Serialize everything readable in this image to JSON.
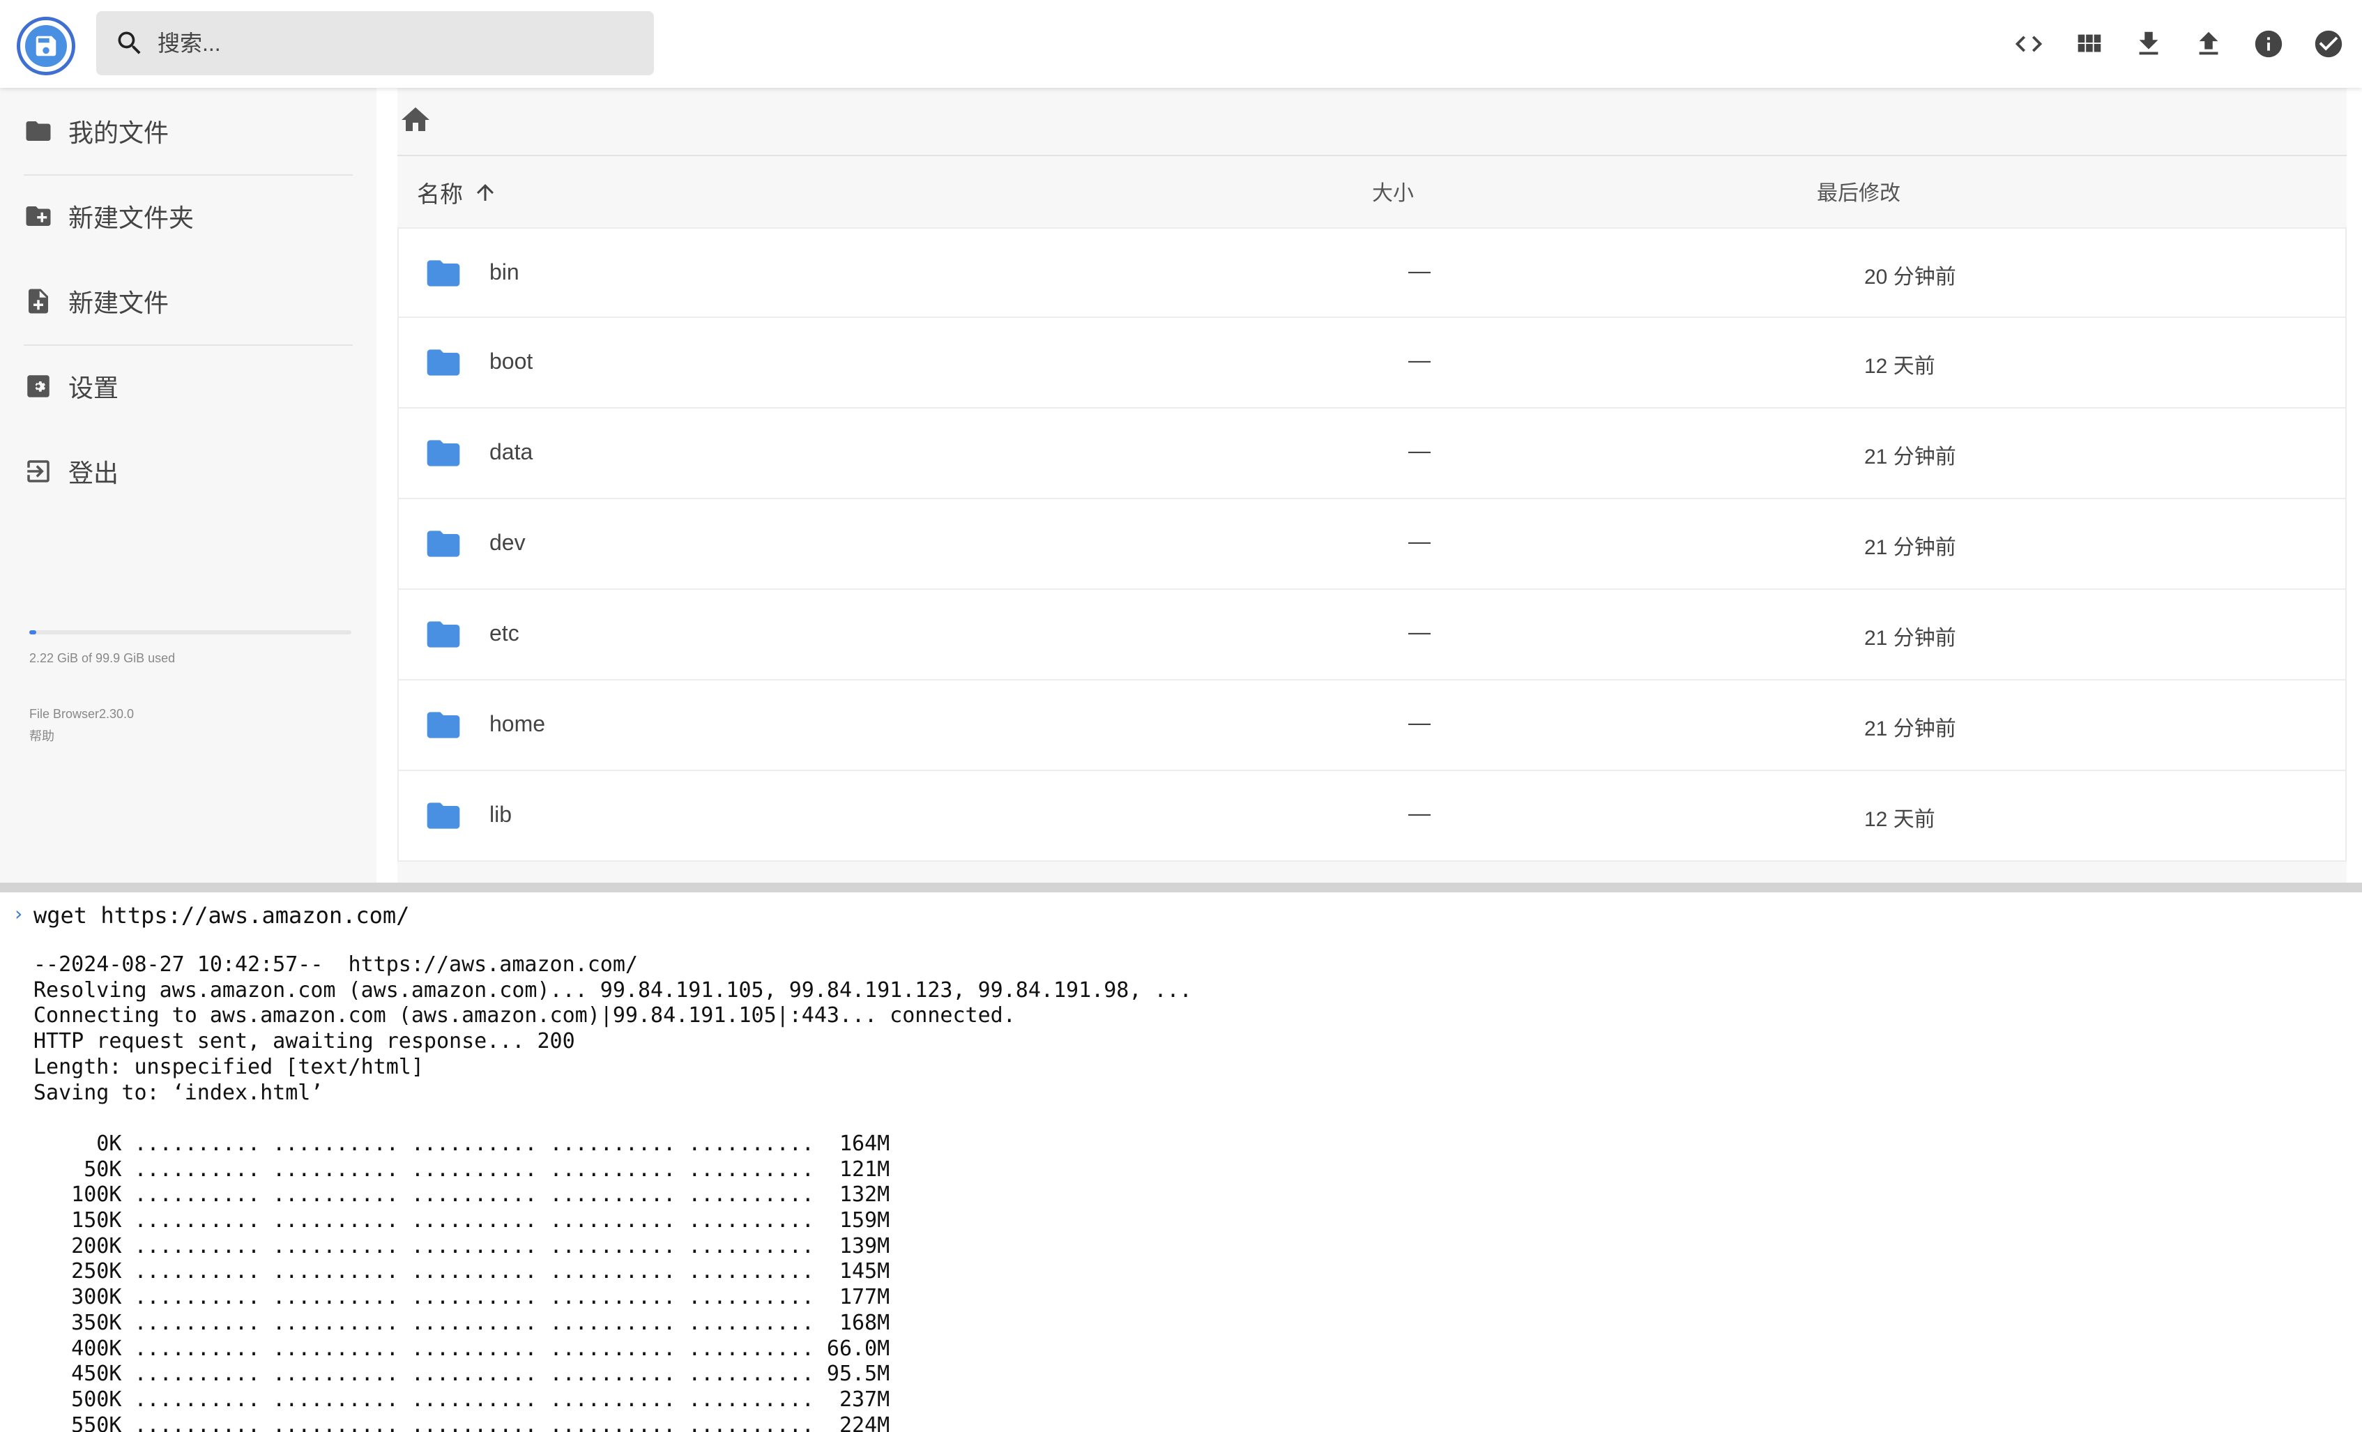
{
  "search": {
    "placeholder": "搜索..."
  },
  "sidebar": {
    "items": [
      {
        "label": "我的文件",
        "icon": "folder-icon"
      },
      {
        "label": "新建文件夹",
        "icon": "new-folder-icon"
      },
      {
        "label": "新建文件",
        "icon": "new-file-icon"
      },
      {
        "label": "设置",
        "icon": "settings-icon"
      },
      {
        "label": "登出",
        "icon": "logout-icon"
      }
    ],
    "usage": {
      "text": "2.22 GiB of 99.9 GiB used",
      "fraction": 0.022
    },
    "version": "File Browser2.30.0",
    "help": "帮助"
  },
  "toolbar": {
    "icons": [
      "code-icon",
      "grid-view-icon",
      "download-icon",
      "upload-icon",
      "info-icon",
      "check-circle-icon"
    ]
  },
  "table": {
    "headers": {
      "name": "名称",
      "size": "大小",
      "modified": "最后修改"
    },
    "sort": "ascending",
    "rows": [
      {
        "name": "bin",
        "size": "—",
        "modified": "20 分钟前"
      },
      {
        "name": "boot",
        "size": "—",
        "modified": "12 天前"
      },
      {
        "name": "data",
        "size": "—",
        "modified": "21 分钟前"
      },
      {
        "name": "dev",
        "size": "—",
        "modified": "21 分钟前"
      },
      {
        "name": "etc",
        "size": "—",
        "modified": "21 分钟前"
      },
      {
        "name": "home",
        "size": "—",
        "modified": "21 分钟前"
      },
      {
        "name": "lib",
        "size": "—",
        "modified": "12 天前"
      }
    ]
  },
  "terminal": {
    "command": "wget https://aws.amazon.com/",
    "output": "--2024-08-27 10:42:57--  https://aws.amazon.com/\nResolving aws.amazon.com (aws.amazon.com)... 99.84.191.105, 99.84.191.123, 99.84.191.98, ...\nConnecting to aws.amazon.com (aws.amazon.com)|99.84.191.105|:443... connected.\nHTTP request sent, awaiting response... 200\nLength: unspecified [text/html]\nSaving to: ‘index.html’\n\n     0K .......... .......... .......... .......... ..........  164M\n    50K .......... .......... .......... .......... ..........  121M\n   100K .......... .......... .......... .......... ..........  132M\n   150K .......... .......... .......... .......... ..........  159M\n   200K .......... .......... .......... .......... ..........  139M\n   250K .......... .......... .......... .......... ..........  145M\n   300K .......... .......... .......... .......... ..........  177M\n   350K .......... .......... .......... .......... ..........  168M\n   400K .......... .......... .......... .......... .......... 66.0M\n   450K .......... .......... .......... .......... .......... 95.5M\n   500K .......... .......... .......... .......... ..........  237M\n   550K .......... .......... .......... .......... ..........  224M"
  },
  "colors": {
    "accent": "#3f7fe6",
    "folder": "#4a90e2"
  }
}
